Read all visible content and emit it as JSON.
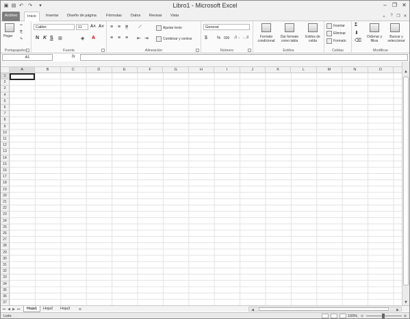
{
  "window": {
    "title": "Libro1 - Microsoft Excel"
  },
  "tabs": {
    "file": "Archivo",
    "items": [
      "Inicio",
      "Insertar",
      "Diseño de página",
      "Fórmulas",
      "Datos",
      "Revisar",
      "Vista"
    ]
  },
  "ribbon": {
    "portapapeles": {
      "label": "Portapapeles",
      "paste": "Pegar"
    },
    "fuente": {
      "label": "Fuente",
      "font": "Calibri",
      "size": "11",
      "bold": "N",
      "italic": "K",
      "underline": "S"
    },
    "alineacion": {
      "label": "Alineación",
      "wrap": "Ajustar texto",
      "merge": "Combinar y centrar"
    },
    "numero": {
      "label": "Número",
      "format": "General",
      "percent": "%",
      "thousands": "000"
    },
    "estilos": {
      "label": "Estilos",
      "conditional": "Formato condicional",
      "table": "Dar formato como tabla",
      "cellstyles": "Estilos de celda"
    },
    "celdas": {
      "label": "Celdas",
      "insert": "Insertar",
      "delete": "Eliminar",
      "format": "Formato"
    },
    "modificar": {
      "label": "Modificar",
      "sort": "Ordenar y filtrar",
      "find": "Buscar y seleccionar",
      "sum": "Σ"
    }
  },
  "formula_bar": {
    "name_box": "A1",
    "fx": "fx",
    "value": ""
  },
  "columns": [
    "A",
    "B",
    "C",
    "D",
    "E",
    "F",
    "G",
    "H",
    "I",
    "J",
    "K",
    "L",
    "M",
    "N",
    "O"
  ],
  "rows": [
    "1",
    "2",
    "3",
    "4",
    "5",
    "6",
    "7",
    "8",
    "9",
    "10",
    "11",
    "12",
    "13",
    "14",
    "15",
    "16",
    "17",
    "18",
    "19",
    "20",
    "21",
    "22",
    "23",
    "24",
    "25",
    "26",
    "27",
    "28",
    "29",
    "30",
    "31",
    "32",
    "33",
    "34",
    "35",
    "36",
    "37"
  ],
  "sheets": [
    "Hoja1",
    "Hoja2",
    "Hoja3"
  ],
  "active_sheet": "Hoja1",
  "status": {
    "text": "Listo",
    "zoom": "100%"
  }
}
